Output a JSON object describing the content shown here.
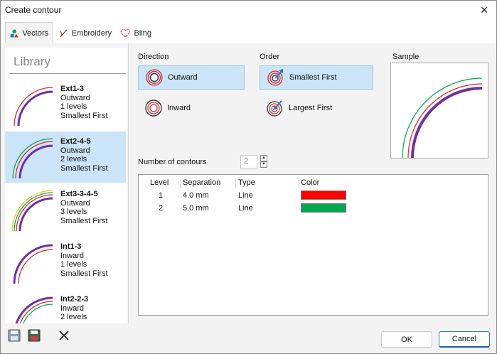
{
  "window": {
    "title": "Create contour"
  },
  "tabs": [
    {
      "label": "Vectors",
      "icon": "vectors-icon",
      "active": true
    },
    {
      "label": "Embroidery",
      "icon": "embroidery-needle-icon",
      "active": false
    },
    {
      "label": "Bling",
      "icon": "bling-heart-icon",
      "active": false
    }
  ],
  "library": {
    "title": "Library",
    "items": [
      {
        "name": "Ext1-3",
        "direction": "Outward",
        "levels": "1 levels",
        "order": "Smallest First",
        "selected": false
      },
      {
        "name": "Ext2-4-5",
        "direction": "Outward",
        "levels": "2 levels",
        "order": "Smallest First",
        "selected": true
      },
      {
        "name": "Ext3-3-4-5",
        "direction": "Outward",
        "levels": "3 levels",
        "order": "Smallest First",
        "selected": false
      },
      {
        "name": "Int1-3",
        "direction": "Inward",
        "levels": "1 levels",
        "order": "Smallest First",
        "selected": false
      },
      {
        "name": "Int2-2-3",
        "direction": "Inward",
        "levels": "2 levels",
        "order": "",
        "selected": false
      }
    ]
  },
  "direction": {
    "label": "Direction",
    "outward": "Outward",
    "inward": "Inward",
    "selected": "Outward"
  },
  "order": {
    "label": "Order",
    "smallest": "Smallest First",
    "largest": "Largest First",
    "selected": "Smallest First"
  },
  "sample": {
    "label": "Sample"
  },
  "contours": {
    "label": "Number of contours",
    "value": "2"
  },
  "table": {
    "headers": [
      "Level",
      "Separation",
      "Type",
      "Color"
    ],
    "rows": [
      {
        "level": "1",
        "separation": "4.0 mm",
        "type": "Line",
        "color": "#ff0000"
      },
      {
        "level": "2",
        "separation": "5.0 mm",
        "type": "Line",
        "color": "#00a650"
      }
    ]
  },
  "footer": {
    "ok": "OK",
    "cancel": "Cancel"
  },
  "colors": {
    "purple": "#7030a0",
    "red": "#e02020",
    "green": "#00a650",
    "yellow": "#f2c200",
    "selection": "#cce4f7",
    "accent": "#2a72c7"
  }
}
